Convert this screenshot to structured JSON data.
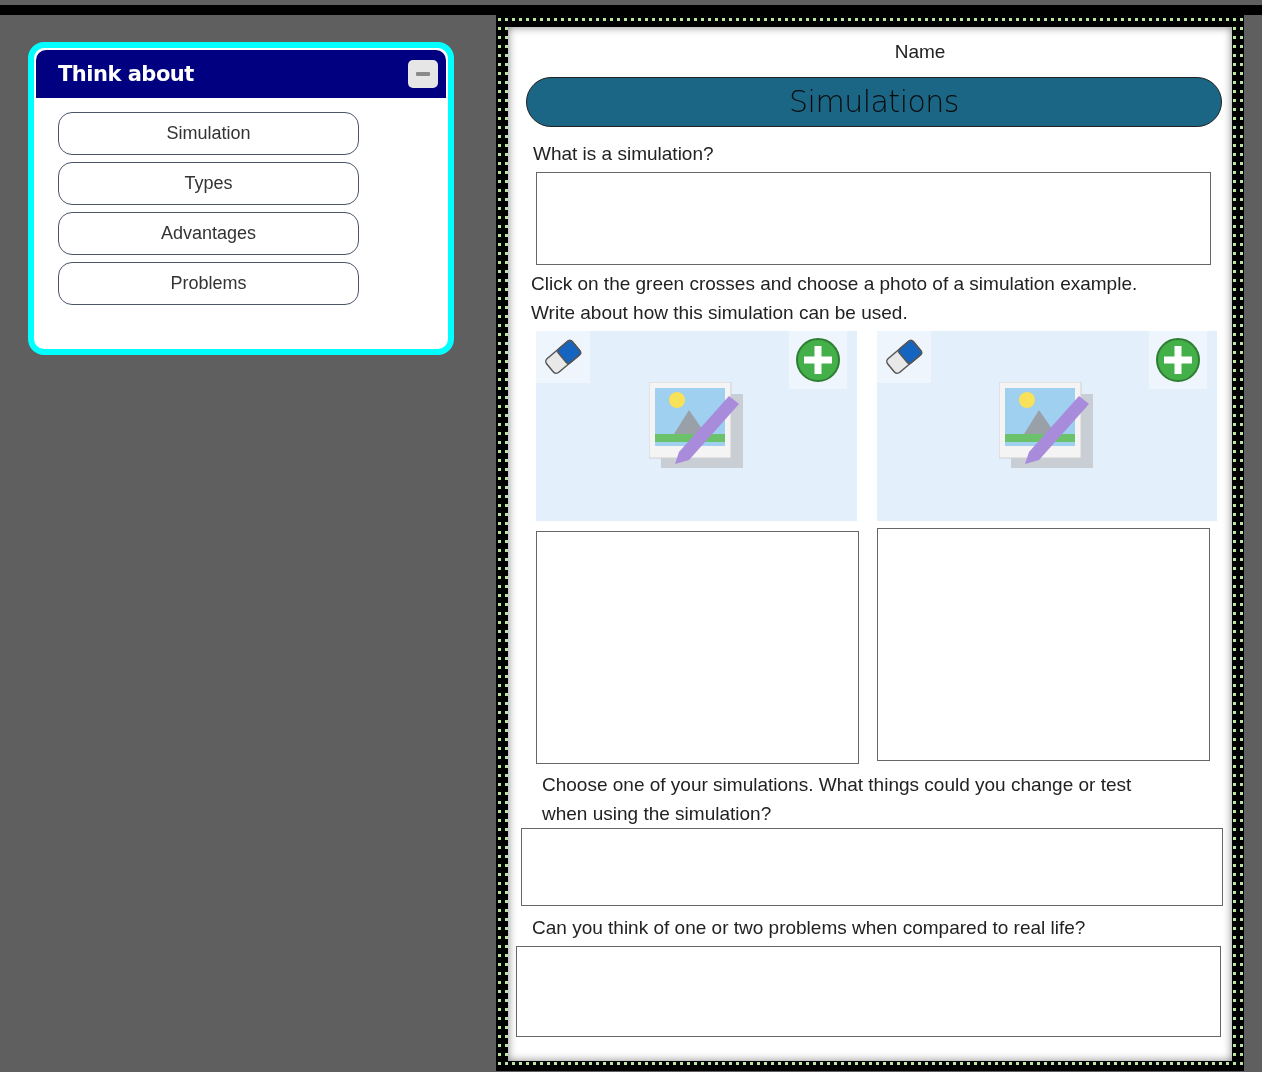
{
  "panel": {
    "title": "Think about",
    "expanded": true,
    "items": [
      {
        "label": "Simulation"
      },
      {
        "label": "Types"
      },
      {
        "label": "Advantages"
      },
      {
        "label": "Problems"
      }
    ]
  },
  "worksheet": {
    "name_label": "Name",
    "title": "Simulations",
    "question_1": "What is a simulation?",
    "instructions": [
      "Click on the green crosses and choose a photo of a simulation example.",
      "Write about how this simulation can be used."
    ],
    "image_slots": [
      {
        "kind": "empty"
      },
      {
        "kind": "empty"
      }
    ],
    "question_2": [
      "Choose one of your simulations. What things could you change or test",
      "when using the simulation?"
    ],
    "question_3": "Can you think of one or two problems when compared to real life?"
  }
}
